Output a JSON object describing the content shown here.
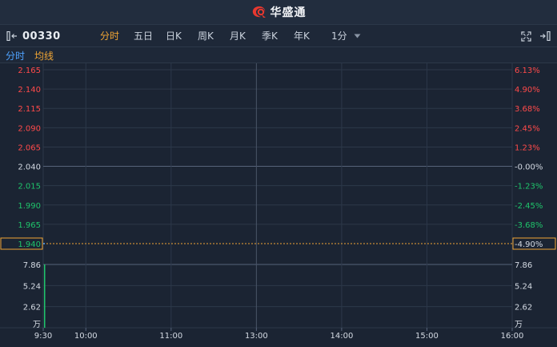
{
  "header": {
    "brand_name": "华盛通"
  },
  "toolbar": {
    "stock_code": "00330",
    "tabs": [
      {
        "label": "分时",
        "active": true
      },
      {
        "label": "五日",
        "active": false
      },
      {
        "label": "日K",
        "active": false
      },
      {
        "label": "周K",
        "active": false
      },
      {
        "label": "月K",
        "active": false
      },
      {
        "label": "季K",
        "active": false
      },
      {
        "label": "年K",
        "active": false
      }
    ],
    "interval": "1分",
    "icons": [
      "collapse-left-icon",
      "dropdown-arrow-icon",
      "fullscreen-icon",
      "expand-right-icon"
    ]
  },
  "legend": {
    "primary": "分时",
    "secondary": "均线"
  },
  "colors": {
    "up": "#ff4a4a",
    "down": "#1fc46b",
    "neutral": "#d4dae3",
    "highlight": "#f0a534",
    "link": "#4fa3ff",
    "background": "#1b2433",
    "grid": "#2c3849"
  },
  "chart_data": {
    "type": "line",
    "price_axis": {
      "ticks": [
        "2.165",
        "2.140",
        "2.115",
        "2.090",
        "2.065",
        "2.040",
        "2.015",
        "1.990",
        "1.965"
      ],
      "values": [
        2.165,
        2.14,
        2.115,
        2.09,
        2.065,
        2.04,
        2.015,
        1.99,
        1.965
      ],
      "pct_ticks": [
        "6.13%",
        "4.90%",
        "3.68%",
        "2.45%",
        "1.23%",
        "-0.00%",
        "-1.23%",
        "-2.45%",
        "-3.68%"
      ],
      "prev_close": 2.04,
      "ylim": [
        1.94,
        2.165
      ]
    },
    "current": {
      "price": "1.940",
      "pct": "-4.90%",
      "value": 1.94
    },
    "volume_axis": {
      "ticks": [
        "7.86",
        "5.24",
        "2.62"
      ],
      "values": [
        7.86,
        5.24,
        2.62
      ],
      "unit": "万",
      "ylim": [
        0,
        7.86
      ]
    },
    "time_axis": {
      "labels": [
        "9:30",
        "10:00",
        "11:00",
        "13:00",
        "14:00",
        "15:00",
        "16:00"
      ]
    },
    "series": [
      {
        "name": "分时",
        "x": [
          "9:30"
        ],
        "values": [
          1.94
        ]
      }
    ],
    "volume": {
      "x": [
        "9:30"
      ],
      "values": [
        7.86
      ]
    }
  }
}
